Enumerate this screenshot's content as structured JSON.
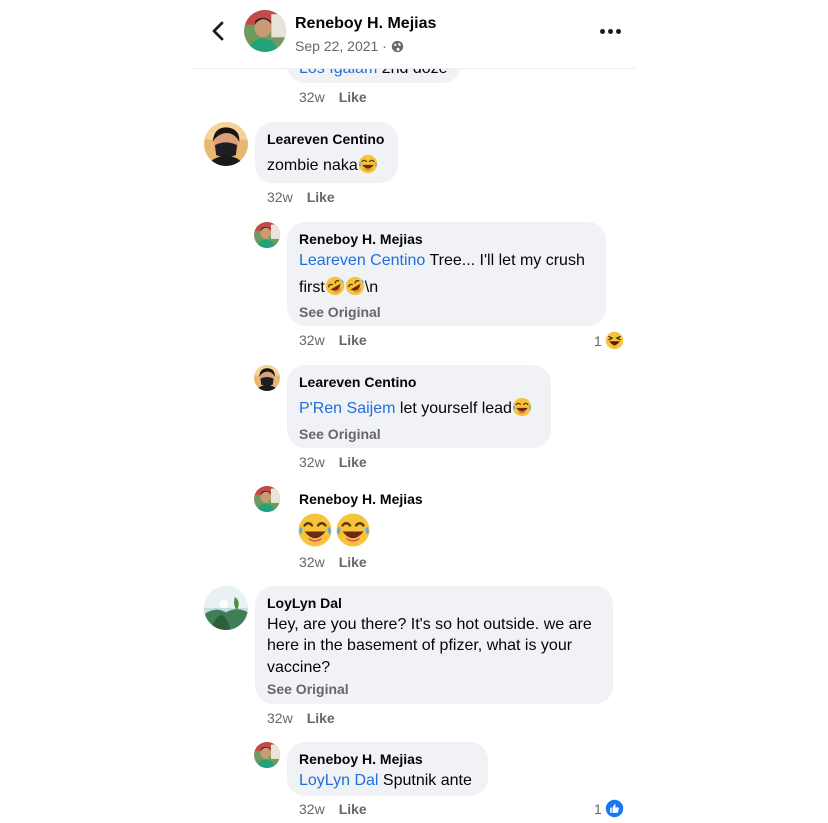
{
  "header": {
    "name": "Reneboy H. Mejias",
    "date": "Sep 22, 2021 ·",
    "privacy_icon": "globe-icon",
    "back_icon": "chevron-left-icon",
    "more_icon": "more-horizontal-icon"
  },
  "colors": {
    "bubble": "#f0f2f5",
    "mention": "#216fdb",
    "meta": "#65676b",
    "like_blue": "#1877f2",
    "haha_yellow": "#f7c33b"
  },
  "comments": [
    {
      "mention": "Los Igalam",
      "text": "2nd doze",
      "time": "32w",
      "like": "Like"
    },
    {
      "name": "Leareven Centino",
      "text": "zombie naka",
      "emoji": "tears-of-joy-icon",
      "time": "32w",
      "like": "Like"
    },
    {
      "name": "Reneboy H. Mejias",
      "mention": "Leareven Centino",
      "text_line1": "Tree... I'll let my crush",
      "text_line2_a": "first",
      "text_line2_b": "\\n",
      "emoji": "rolling-laugh-icon",
      "see_original": "See Original",
      "time": "32w",
      "like": "Like",
      "reaction_count": "1",
      "reaction_icon": "haha-reaction-icon"
    },
    {
      "name": "Leareven Centino",
      "mention": "P'Ren Saijem",
      "text": "let yourself lead",
      "emoji": "tears-of-joy-icon",
      "see_original": "See Original",
      "time": "32w",
      "like": "Like"
    },
    {
      "name": "Reneboy H. Mejias",
      "emoji": "tears-of-joy-icon",
      "time": "32w",
      "like": "Like"
    },
    {
      "name": "LoyLyn Dal",
      "text_line1": "Hey, are you there? It's so hot outside. we are",
      "text_line2": "here in the basement of pfizer, what is your",
      "text_line3": "vaccine?",
      "see_original": "See Original",
      "time": "32w",
      "like": "Like"
    },
    {
      "name": "Reneboy H. Mejias",
      "mention": "LoyLyn Dal",
      "text": "Sputnik ante",
      "time": "32w",
      "like": "Like",
      "reaction_count": "1",
      "reaction_icon": "like-reaction-icon"
    }
  ]
}
